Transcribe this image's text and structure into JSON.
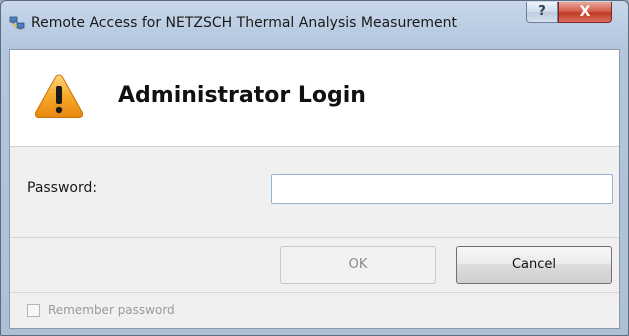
{
  "window": {
    "title": "Remote Access for NETZSCH Thermal Analysis Measurement",
    "help_label": "?",
    "close_label": "X",
    "app_icon": "network-computers-icon"
  },
  "header": {
    "title": "Administrator Login",
    "icon": "warning-icon",
    "icon_glyph": "!",
    "icon_color": "#f5a623"
  },
  "form": {
    "password_label": "Password:",
    "password_value": "",
    "password_placeholder": ""
  },
  "buttons": {
    "ok_label": "OK",
    "ok_enabled": false,
    "cancel_label": "Cancel"
  },
  "footer": {
    "remember_label": "Remember password",
    "remember_checked": false,
    "remember_enabled": false
  }
}
